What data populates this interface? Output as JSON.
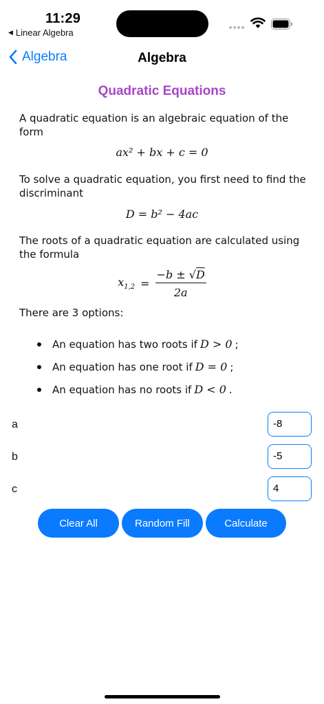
{
  "status_bar": {
    "time": "11:29",
    "back_app": "Linear Algebra"
  },
  "nav": {
    "back_label": "Algebra",
    "title": "Algebra"
  },
  "content": {
    "section_title": "Quadratic Equations",
    "intro": "A quadratic equation is an algebraic equation of the form",
    "formula_general": "ax² + bx + c = 0",
    "discriminant_text": "To solve a quadratic equation, you first need to find the discriminant",
    "formula_discriminant": "D = b² − 4ac",
    "roots_text": "The roots of a quadratic equation are calculated using the formula",
    "formula_roots": {
      "lhs": "x",
      "lhs_sub": "1,2",
      "numerator_prefix": "−b ± √",
      "numerator_radicand": "D",
      "denominator": "2a"
    },
    "options_text": "There are 3 options:",
    "options": [
      {
        "text": "An equation has two roots if",
        "math": "D > 0",
        "suffix": ";"
      },
      {
        "text": "An equation has one root if",
        "math": "D = 0",
        "suffix": ";"
      },
      {
        "text": "An equation has no roots if",
        "math": "D < 0",
        "suffix": "."
      }
    ]
  },
  "inputs": [
    {
      "label": "a",
      "value": "-8"
    },
    {
      "label": "b",
      "value": "-5"
    },
    {
      "label": "c",
      "value": "4"
    }
  ],
  "buttons": {
    "clear": "Clear All",
    "random": "Random Fill",
    "calculate": "Calculate"
  },
  "colors": {
    "accent": "#0a7aff",
    "section_title": "#a846c8"
  },
  "icons": [
    "back-chevron-icon",
    "wifi-icon",
    "battery-icon",
    "signal-dots-icon"
  ]
}
